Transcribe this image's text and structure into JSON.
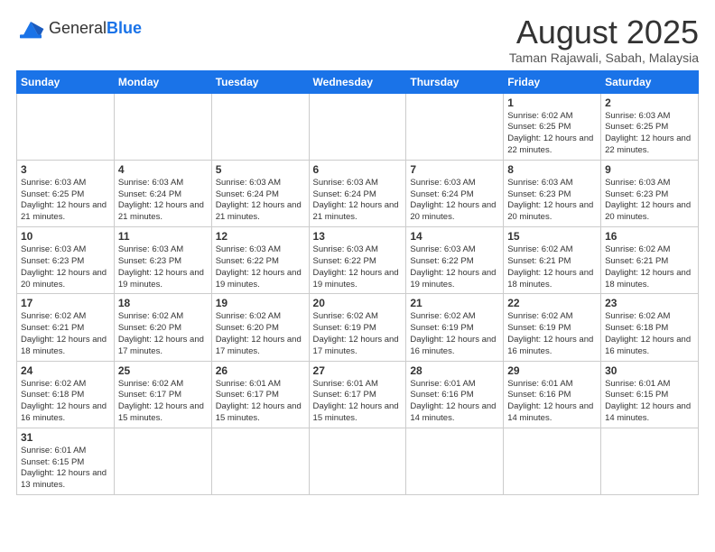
{
  "header": {
    "logo_general": "General",
    "logo_blue": "Blue",
    "title": "August 2025",
    "subtitle": "Taman Rajawali, Sabah, Malaysia"
  },
  "weekdays": [
    "Sunday",
    "Monday",
    "Tuesday",
    "Wednesday",
    "Thursday",
    "Friday",
    "Saturday"
  ],
  "weeks": [
    [
      {
        "day": "",
        "info": ""
      },
      {
        "day": "",
        "info": ""
      },
      {
        "day": "",
        "info": ""
      },
      {
        "day": "",
        "info": ""
      },
      {
        "day": "",
        "info": ""
      },
      {
        "day": "1",
        "info": "Sunrise: 6:02 AM\nSunset: 6:25 PM\nDaylight: 12 hours and 22 minutes."
      },
      {
        "day": "2",
        "info": "Sunrise: 6:03 AM\nSunset: 6:25 PM\nDaylight: 12 hours and 22 minutes."
      }
    ],
    [
      {
        "day": "3",
        "info": "Sunrise: 6:03 AM\nSunset: 6:25 PM\nDaylight: 12 hours and 21 minutes."
      },
      {
        "day": "4",
        "info": "Sunrise: 6:03 AM\nSunset: 6:24 PM\nDaylight: 12 hours and 21 minutes."
      },
      {
        "day": "5",
        "info": "Sunrise: 6:03 AM\nSunset: 6:24 PM\nDaylight: 12 hours and 21 minutes."
      },
      {
        "day": "6",
        "info": "Sunrise: 6:03 AM\nSunset: 6:24 PM\nDaylight: 12 hours and 21 minutes."
      },
      {
        "day": "7",
        "info": "Sunrise: 6:03 AM\nSunset: 6:24 PM\nDaylight: 12 hours and 20 minutes."
      },
      {
        "day": "8",
        "info": "Sunrise: 6:03 AM\nSunset: 6:23 PM\nDaylight: 12 hours and 20 minutes."
      },
      {
        "day": "9",
        "info": "Sunrise: 6:03 AM\nSunset: 6:23 PM\nDaylight: 12 hours and 20 minutes."
      }
    ],
    [
      {
        "day": "10",
        "info": "Sunrise: 6:03 AM\nSunset: 6:23 PM\nDaylight: 12 hours and 20 minutes."
      },
      {
        "day": "11",
        "info": "Sunrise: 6:03 AM\nSunset: 6:23 PM\nDaylight: 12 hours and 19 minutes."
      },
      {
        "day": "12",
        "info": "Sunrise: 6:03 AM\nSunset: 6:22 PM\nDaylight: 12 hours and 19 minutes."
      },
      {
        "day": "13",
        "info": "Sunrise: 6:03 AM\nSunset: 6:22 PM\nDaylight: 12 hours and 19 minutes."
      },
      {
        "day": "14",
        "info": "Sunrise: 6:03 AM\nSunset: 6:22 PM\nDaylight: 12 hours and 19 minutes."
      },
      {
        "day": "15",
        "info": "Sunrise: 6:02 AM\nSunset: 6:21 PM\nDaylight: 12 hours and 18 minutes."
      },
      {
        "day": "16",
        "info": "Sunrise: 6:02 AM\nSunset: 6:21 PM\nDaylight: 12 hours and 18 minutes."
      }
    ],
    [
      {
        "day": "17",
        "info": "Sunrise: 6:02 AM\nSunset: 6:21 PM\nDaylight: 12 hours and 18 minutes."
      },
      {
        "day": "18",
        "info": "Sunrise: 6:02 AM\nSunset: 6:20 PM\nDaylight: 12 hours and 17 minutes."
      },
      {
        "day": "19",
        "info": "Sunrise: 6:02 AM\nSunset: 6:20 PM\nDaylight: 12 hours and 17 minutes."
      },
      {
        "day": "20",
        "info": "Sunrise: 6:02 AM\nSunset: 6:19 PM\nDaylight: 12 hours and 17 minutes."
      },
      {
        "day": "21",
        "info": "Sunrise: 6:02 AM\nSunset: 6:19 PM\nDaylight: 12 hours and 16 minutes."
      },
      {
        "day": "22",
        "info": "Sunrise: 6:02 AM\nSunset: 6:19 PM\nDaylight: 12 hours and 16 minutes."
      },
      {
        "day": "23",
        "info": "Sunrise: 6:02 AM\nSunset: 6:18 PM\nDaylight: 12 hours and 16 minutes."
      }
    ],
    [
      {
        "day": "24",
        "info": "Sunrise: 6:02 AM\nSunset: 6:18 PM\nDaylight: 12 hours and 16 minutes."
      },
      {
        "day": "25",
        "info": "Sunrise: 6:02 AM\nSunset: 6:17 PM\nDaylight: 12 hours and 15 minutes."
      },
      {
        "day": "26",
        "info": "Sunrise: 6:01 AM\nSunset: 6:17 PM\nDaylight: 12 hours and 15 minutes."
      },
      {
        "day": "27",
        "info": "Sunrise: 6:01 AM\nSunset: 6:17 PM\nDaylight: 12 hours and 15 minutes."
      },
      {
        "day": "28",
        "info": "Sunrise: 6:01 AM\nSunset: 6:16 PM\nDaylight: 12 hours and 14 minutes."
      },
      {
        "day": "29",
        "info": "Sunrise: 6:01 AM\nSunset: 6:16 PM\nDaylight: 12 hours and 14 minutes."
      },
      {
        "day": "30",
        "info": "Sunrise: 6:01 AM\nSunset: 6:15 PM\nDaylight: 12 hours and 14 minutes."
      }
    ],
    [
      {
        "day": "31",
        "info": "Sunrise: 6:01 AM\nSunset: 6:15 PM\nDaylight: 12 hours and 13 minutes."
      },
      {
        "day": "",
        "info": ""
      },
      {
        "day": "",
        "info": ""
      },
      {
        "day": "",
        "info": ""
      },
      {
        "day": "",
        "info": ""
      },
      {
        "day": "",
        "info": ""
      },
      {
        "day": "",
        "info": ""
      }
    ]
  ]
}
